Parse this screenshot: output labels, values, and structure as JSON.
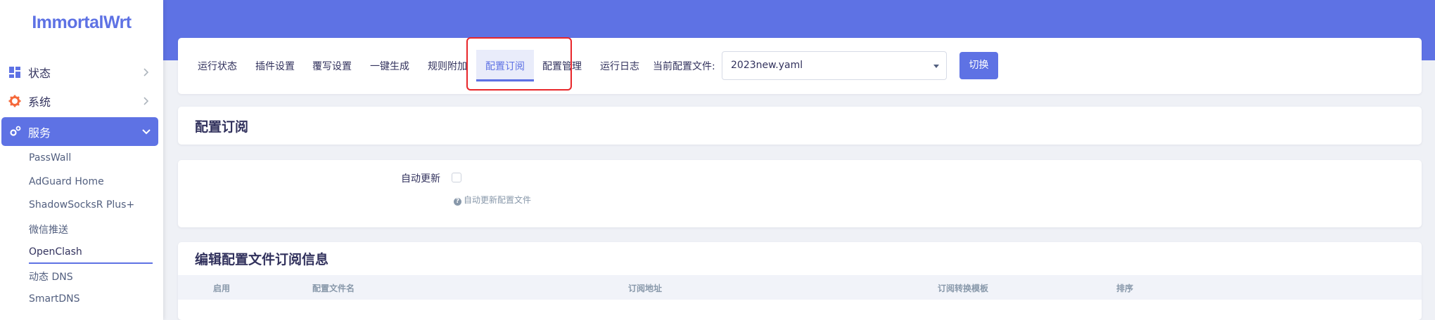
{
  "sidebar": {
    "logo": "ImmortalWrt",
    "menu": [
      {
        "label": "状态"
      },
      {
        "label": "系统"
      },
      {
        "label": "服务"
      }
    ],
    "services_items": [
      {
        "label": "PassWall"
      },
      {
        "label": "AdGuard Home"
      },
      {
        "label": "ShadowSocksR Plus+"
      },
      {
        "label": "微信推送"
      },
      {
        "label": "OpenClash"
      },
      {
        "label": "动态 DNS"
      },
      {
        "label": "SmartDNS"
      }
    ]
  },
  "tabs": [
    {
      "label": "运行状态"
    },
    {
      "label": "插件设置"
    },
    {
      "label": "覆写设置"
    },
    {
      "label": "一键生成"
    },
    {
      "label": "规则附加"
    },
    {
      "label": "配置订阅"
    },
    {
      "label": "配置管理"
    },
    {
      "label": "运行日志"
    }
  ],
  "active_tab": "配置订阅",
  "config": {
    "label": "当前配置文件:",
    "value": "2023new.yaml",
    "switch_label": "切换"
  },
  "section_title": "配置订阅",
  "auto_update": {
    "label": "自动更新",
    "checked": false,
    "help": "自动更新配置文件"
  },
  "subscription": {
    "title": "编辑配置文件订阅信息",
    "columns": [
      "启用",
      "配置文件名",
      "订阅地址",
      "订阅转换模板",
      "排序"
    ]
  },
  "colors": {
    "accent": "#5e72e4",
    "highlight": "#e8262a",
    "system_icon": "#f5693b"
  }
}
